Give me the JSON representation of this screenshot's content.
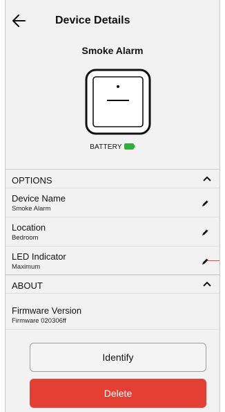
{
  "header": {
    "title": "Device Details",
    "back_icon": "arrow-left-icon"
  },
  "device": {
    "name": "Smoke Alarm",
    "icon": "smoke-alarm-icon"
  },
  "battery": {
    "label": "BATTERY",
    "status_color": "#2fae3c"
  },
  "options": {
    "title": "OPTIONS",
    "rows": [
      {
        "label": "Device Name",
        "value": "Smoke Alarm",
        "icon": "pencil-icon"
      },
      {
        "label": "Location",
        "value": "Bedroom",
        "icon": "pencil-icon"
      },
      {
        "label": "LED Indicator",
        "value": "Maximum",
        "icon": "pencil-icon"
      }
    ]
  },
  "about": {
    "title": "ABOUT",
    "rows": [
      {
        "label": "Firmware Version",
        "value": "Firmware 020306ff"
      }
    ]
  },
  "actions": {
    "identify_label": "Identify",
    "delete_label": "Delete"
  },
  "colors": {
    "delete": "#e53e32",
    "background": "#f2f2f2"
  }
}
